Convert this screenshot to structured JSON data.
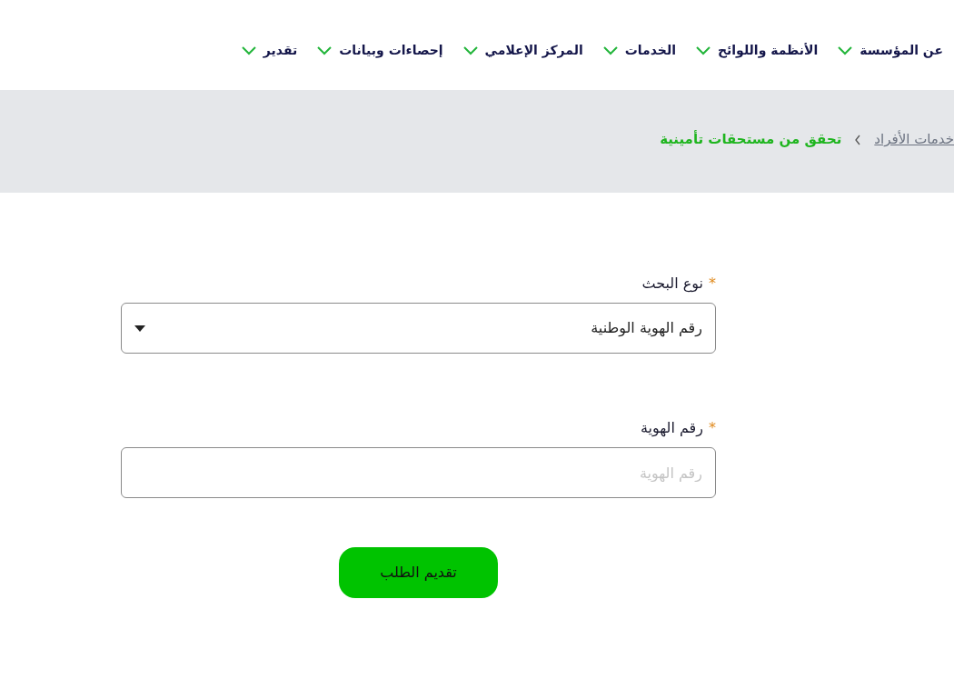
{
  "nav": [
    {
      "label": "عن المؤسسة"
    },
    {
      "label": "الأنظمة واللوائح"
    },
    {
      "label": "الخدمات"
    },
    {
      "label": "المركز الإعلامي"
    },
    {
      "label": "إحصاءات وبيانات"
    },
    {
      "label": "تقدير"
    }
  ],
  "breadcrumb": [
    {
      "label": "خدمات الأفراد",
      "current": false
    },
    {
      "label": "تحقق من مستحقات تأمينية",
      "current": true
    }
  ],
  "form": {
    "fields": [
      {
        "kind": "select",
        "label": "نوع البحث",
        "required_mark": "*",
        "value": "رقم الهوية الوطنية"
      },
      {
        "kind": "text",
        "label": "رقم الهوية",
        "required_mark": "*",
        "placeholder": "رقم الهوية"
      }
    ],
    "submit": "تقديم الطلب"
  }
}
